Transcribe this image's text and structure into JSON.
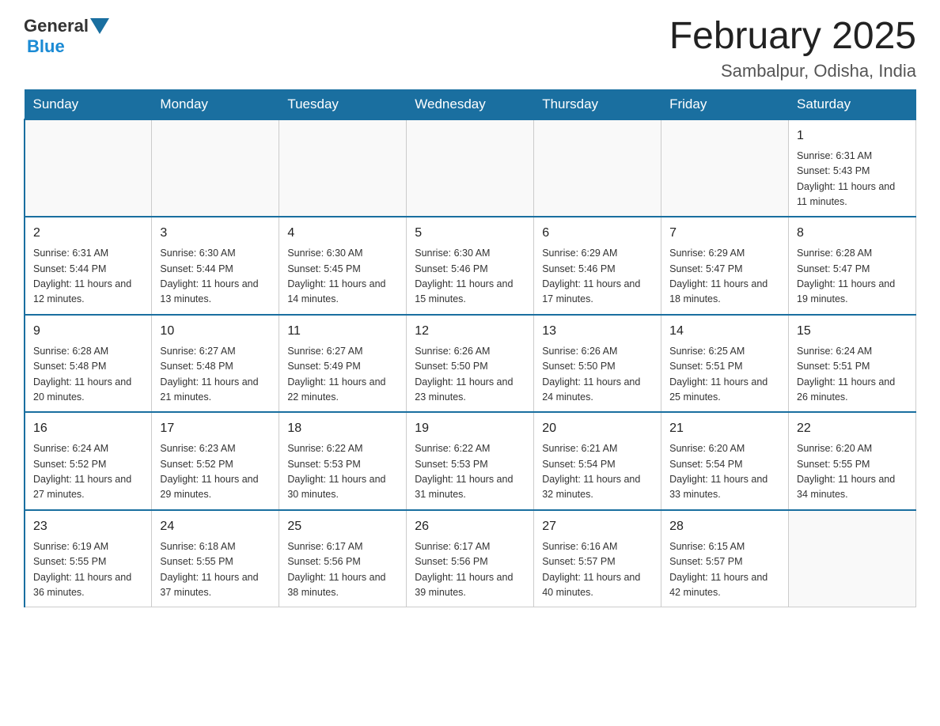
{
  "header": {
    "logo_general": "General",
    "logo_blue": "Blue",
    "month_title": "February 2025",
    "location": "Sambalpur, Odisha, India"
  },
  "days_of_week": [
    "Sunday",
    "Monday",
    "Tuesday",
    "Wednesday",
    "Thursday",
    "Friday",
    "Saturday"
  ],
  "weeks": [
    {
      "days": [
        {
          "num": "",
          "info": ""
        },
        {
          "num": "",
          "info": ""
        },
        {
          "num": "",
          "info": ""
        },
        {
          "num": "",
          "info": ""
        },
        {
          "num": "",
          "info": ""
        },
        {
          "num": "",
          "info": ""
        },
        {
          "num": "1",
          "info": "Sunrise: 6:31 AM\nSunset: 5:43 PM\nDaylight: 11 hours\nand 11 minutes."
        }
      ]
    },
    {
      "days": [
        {
          "num": "2",
          "info": "Sunrise: 6:31 AM\nSunset: 5:44 PM\nDaylight: 11 hours\nand 12 minutes."
        },
        {
          "num": "3",
          "info": "Sunrise: 6:30 AM\nSunset: 5:44 PM\nDaylight: 11 hours\nand 13 minutes."
        },
        {
          "num": "4",
          "info": "Sunrise: 6:30 AM\nSunset: 5:45 PM\nDaylight: 11 hours\nand 14 minutes."
        },
        {
          "num": "5",
          "info": "Sunrise: 6:30 AM\nSunset: 5:46 PM\nDaylight: 11 hours\nand 15 minutes."
        },
        {
          "num": "6",
          "info": "Sunrise: 6:29 AM\nSunset: 5:46 PM\nDaylight: 11 hours\nand 17 minutes."
        },
        {
          "num": "7",
          "info": "Sunrise: 6:29 AM\nSunset: 5:47 PM\nDaylight: 11 hours\nand 18 minutes."
        },
        {
          "num": "8",
          "info": "Sunrise: 6:28 AM\nSunset: 5:47 PM\nDaylight: 11 hours\nand 19 minutes."
        }
      ]
    },
    {
      "days": [
        {
          "num": "9",
          "info": "Sunrise: 6:28 AM\nSunset: 5:48 PM\nDaylight: 11 hours\nand 20 minutes."
        },
        {
          "num": "10",
          "info": "Sunrise: 6:27 AM\nSunset: 5:48 PM\nDaylight: 11 hours\nand 21 minutes."
        },
        {
          "num": "11",
          "info": "Sunrise: 6:27 AM\nSunset: 5:49 PM\nDaylight: 11 hours\nand 22 minutes."
        },
        {
          "num": "12",
          "info": "Sunrise: 6:26 AM\nSunset: 5:50 PM\nDaylight: 11 hours\nand 23 minutes."
        },
        {
          "num": "13",
          "info": "Sunrise: 6:26 AM\nSunset: 5:50 PM\nDaylight: 11 hours\nand 24 minutes."
        },
        {
          "num": "14",
          "info": "Sunrise: 6:25 AM\nSunset: 5:51 PM\nDaylight: 11 hours\nand 25 minutes."
        },
        {
          "num": "15",
          "info": "Sunrise: 6:24 AM\nSunset: 5:51 PM\nDaylight: 11 hours\nand 26 minutes."
        }
      ]
    },
    {
      "days": [
        {
          "num": "16",
          "info": "Sunrise: 6:24 AM\nSunset: 5:52 PM\nDaylight: 11 hours\nand 27 minutes."
        },
        {
          "num": "17",
          "info": "Sunrise: 6:23 AM\nSunset: 5:52 PM\nDaylight: 11 hours\nand 29 minutes."
        },
        {
          "num": "18",
          "info": "Sunrise: 6:22 AM\nSunset: 5:53 PM\nDaylight: 11 hours\nand 30 minutes."
        },
        {
          "num": "19",
          "info": "Sunrise: 6:22 AM\nSunset: 5:53 PM\nDaylight: 11 hours\nand 31 minutes."
        },
        {
          "num": "20",
          "info": "Sunrise: 6:21 AM\nSunset: 5:54 PM\nDaylight: 11 hours\nand 32 minutes."
        },
        {
          "num": "21",
          "info": "Sunrise: 6:20 AM\nSunset: 5:54 PM\nDaylight: 11 hours\nand 33 minutes."
        },
        {
          "num": "22",
          "info": "Sunrise: 6:20 AM\nSunset: 5:55 PM\nDaylight: 11 hours\nand 34 minutes."
        }
      ]
    },
    {
      "days": [
        {
          "num": "23",
          "info": "Sunrise: 6:19 AM\nSunset: 5:55 PM\nDaylight: 11 hours\nand 36 minutes."
        },
        {
          "num": "24",
          "info": "Sunrise: 6:18 AM\nSunset: 5:55 PM\nDaylight: 11 hours\nand 37 minutes."
        },
        {
          "num": "25",
          "info": "Sunrise: 6:17 AM\nSunset: 5:56 PM\nDaylight: 11 hours\nand 38 minutes."
        },
        {
          "num": "26",
          "info": "Sunrise: 6:17 AM\nSunset: 5:56 PM\nDaylight: 11 hours\nand 39 minutes."
        },
        {
          "num": "27",
          "info": "Sunrise: 6:16 AM\nSunset: 5:57 PM\nDaylight: 11 hours\nand 40 minutes."
        },
        {
          "num": "28",
          "info": "Sunrise: 6:15 AM\nSunset: 5:57 PM\nDaylight: 11 hours\nand 42 minutes."
        },
        {
          "num": "",
          "info": ""
        }
      ]
    }
  ]
}
